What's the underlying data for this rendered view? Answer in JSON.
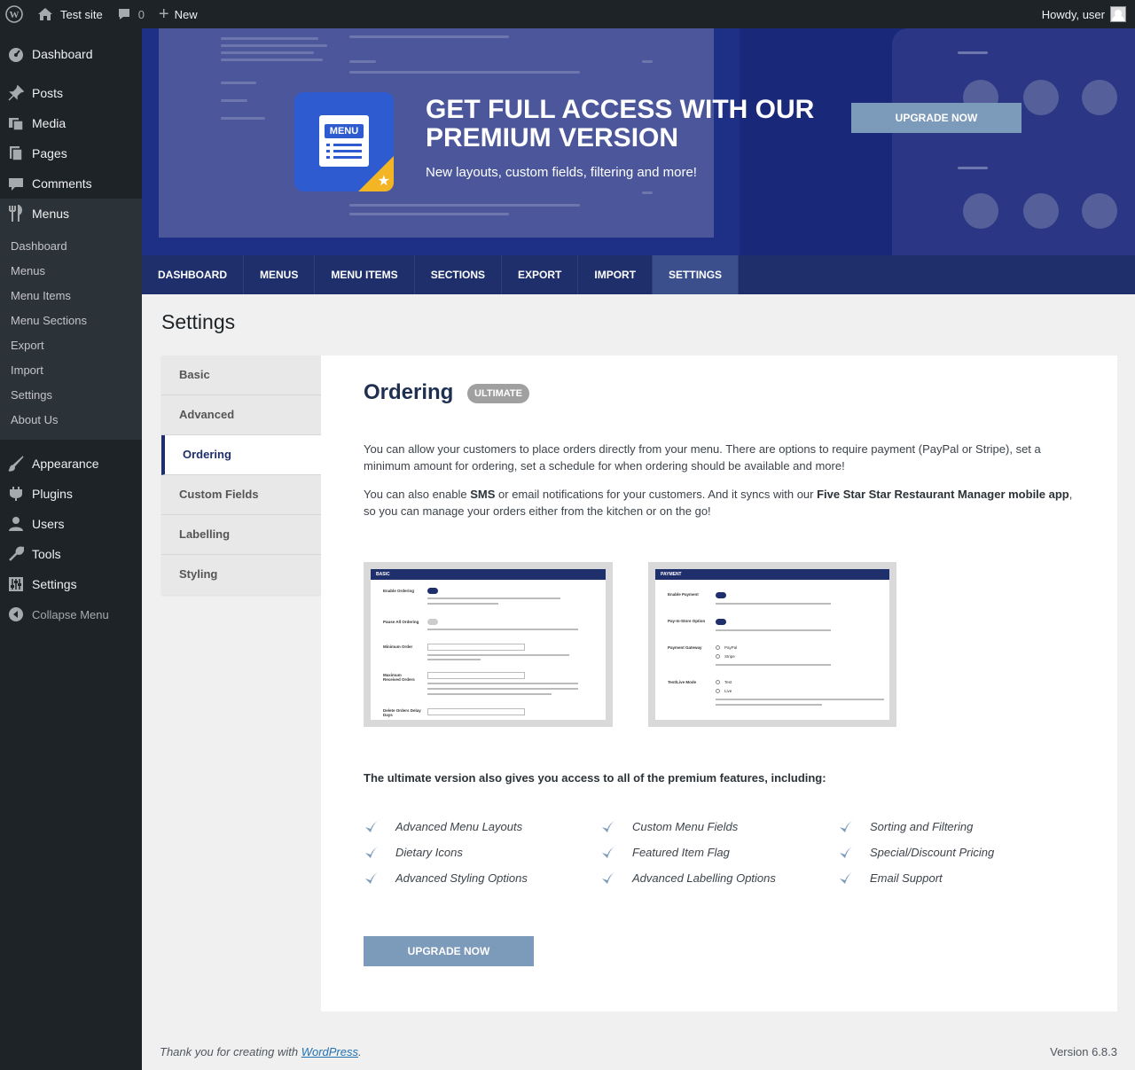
{
  "admin_bar": {
    "site_name": "Test site",
    "comments_count": "0",
    "new_label": "New",
    "greeting": "Howdy, user"
  },
  "sidebar": {
    "items": [
      {
        "label": "Dashboard",
        "icon": "dashboard-icon"
      },
      {
        "label": "Posts",
        "icon": "pin-icon"
      },
      {
        "label": "Media",
        "icon": "media-icon"
      },
      {
        "label": "Pages",
        "icon": "pages-icon"
      },
      {
        "label": "Comments",
        "icon": "comment-icon"
      },
      {
        "label": "Menus",
        "icon": "utensils-icon"
      }
    ],
    "submenu": [
      "Dashboard",
      "Menus",
      "Menu Items",
      "Menu Sections",
      "Export",
      "Import",
      "Settings",
      "About Us"
    ],
    "items_after": [
      {
        "label": "Appearance",
        "icon": "brush-icon"
      },
      {
        "label": "Plugins",
        "icon": "plug-icon"
      },
      {
        "label": "Users",
        "icon": "user-icon"
      },
      {
        "label": "Tools",
        "icon": "wrench-icon"
      },
      {
        "label": "Settings",
        "icon": "sliders-icon"
      }
    ],
    "collapse_label": "Collapse Menu"
  },
  "banner": {
    "logo_text": "MENU",
    "title": "GET FULL ACCESS WITH OUR PREMIUM VERSION",
    "subtitle": "New layouts, custom fields, filtering and more!",
    "button": "UPGRADE NOW"
  },
  "tabs": [
    "DASHBOARD",
    "MENUS",
    "MENU ITEMS",
    "SECTIONS",
    "EXPORT",
    "IMPORT",
    "SETTINGS"
  ],
  "active_tab": "SETTINGS",
  "page_title": "Settings",
  "settings_nav": [
    "Basic",
    "Advanced",
    "Ordering",
    "Custom Fields",
    "Labelling",
    "Styling"
  ],
  "settings_nav_active": "Ordering",
  "panel": {
    "title": "Ordering",
    "badge": "ULTIMATE",
    "para1": "You can allow your customers to place orders directly from your menu. There are options to require payment (PayPal or Stripe), set a minimum amount for ordering, set a schedule for when ordering should be available and more!",
    "para2_a": "You can also enable ",
    "para2_sms": "SMS",
    "para2_b": " or email notifications for your customers. And it syncs with our ",
    "para2_app": "Five Star Star Restaurant Manager mobile app",
    "para2_c": ", so you can manage your orders either from the kitchen or on the go!",
    "shot1": {
      "header": "BASIC",
      "rows": [
        "Enable Ordering",
        "Pause All Ordering",
        "Minimum Order",
        "Maximum Received Orders",
        "Delete Orders Delay Days"
      ]
    },
    "shot2": {
      "header": "PAYMENT",
      "rows": [
        "Enable Payment",
        "Pay-In-Store Option",
        "Payment Gateway",
        "Test/Live Mode"
      ],
      "options": [
        "PayPal",
        "Stripe",
        "Test",
        "Live"
      ]
    },
    "features_heading": "The ultimate version also gives you access to all of the premium features, including:",
    "features": [
      "Advanced Menu Layouts",
      "Custom Menu Fields",
      "Sorting and Filtering",
      "Dietary Icons",
      "Featured Item Flag",
      "Special/Discount Pricing",
      "Advanced Styling Options",
      "Advanced Labelling Options",
      "Email Support"
    ],
    "button": "UPGRADE NOW"
  },
  "footer": {
    "thanks_prefix": "Thank you for creating with ",
    "link": "WordPress",
    "suffix": ".",
    "version": "Version 6.8.3"
  },
  "colors": {
    "accent": "#1e2f6b",
    "banner_bg": "#1e2f86",
    "button": "#7c9ab9",
    "admin_dark": "#1d2327"
  }
}
